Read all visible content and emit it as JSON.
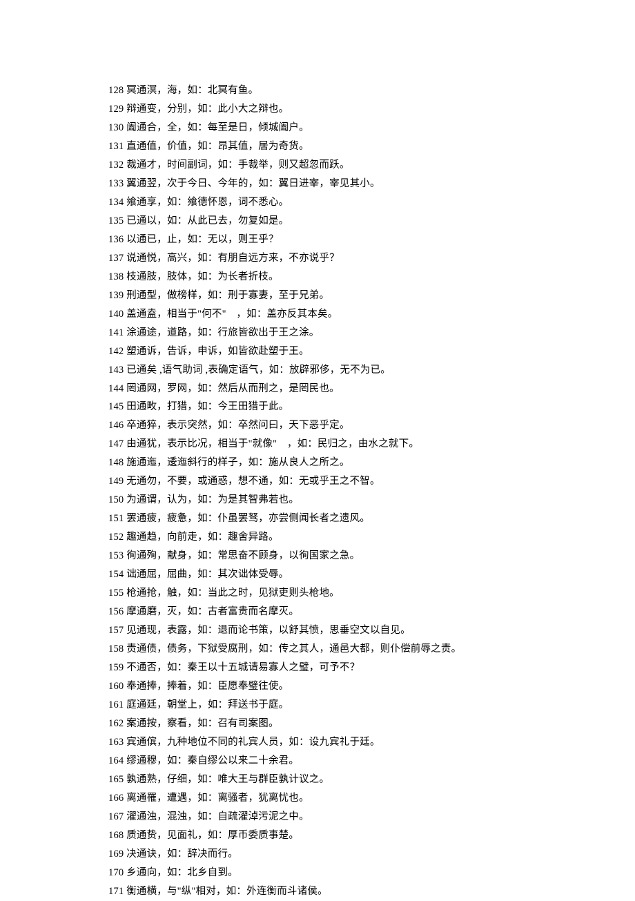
{
  "entries": [
    {
      "num": 128,
      "text": "冥通溟，海，如：北冥有鱼。"
    },
    {
      "num": 129,
      "text": "辩通变，分别，如：此小大之辩也。"
    },
    {
      "num": 130,
      "text": "阖通合，全，如：每至是日，倾城阖户。"
    },
    {
      "num": 131,
      "text": "直通值，价值，如：昂其值，居为奇货。"
    },
    {
      "num": 132,
      "text": "裁通才，时间副词，如：手裁举，则又超忽而跃。"
    },
    {
      "num": 133,
      "text": "翼通翌，次于今日、今年的，如：翼日进宰，宰见其小。"
    },
    {
      "num": 134,
      "text": "飨通享，如：飨德怀恩，词不悉心。"
    },
    {
      "num": 135,
      "text": "已通以，如：从此已去，勿复如是。"
    },
    {
      "num": 136,
      "text": "以通已，止，如：无以，则王乎？"
    },
    {
      "num": 137,
      "text": "说通悦，高兴，如：有朋自远方来，不亦说乎？"
    },
    {
      "num": 138,
      "text": "枝通肢，肢体，如：为长者折枝。"
    },
    {
      "num": 139,
      "text": "刑通型，做榜样，如：刑于寡妻，至于兄弟。"
    },
    {
      "num": 140,
      "text": "盖通盍，相当于\"何不\"　，如：盖亦反其本矣。"
    },
    {
      "num": 141,
      "text": "涂通途，道路，如：行旅皆欲出于王之涂。"
    },
    {
      "num": 142,
      "text": "塑通诉，告诉，申诉，如皆欲赴塑于王。"
    },
    {
      "num": 143,
      "text": "已通矣 ,语气助词 ,表确定语气，如：放辟邪侈，无不为已。"
    },
    {
      "num": 144,
      "text": "罔通网，罗网，如：然后从而刑之，是罔民也。"
    },
    {
      "num": 145,
      "text": "田通畋，打猎，如：今王田猎于此。"
    },
    {
      "num": 146,
      "text": "卒通猝，表示突然，如：卒然问曰，天下恶乎定。"
    },
    {
      "num": 147,
      "text": "由通犹，表示比况，相当于\"就像\"　，如：民归之，由水之就下。"
    },
    {
      "num": 148,
      "text": "施通迤，逶迤斜行的样子，如：施从良人之所之。"
    },
    {
      "num": 149,
      "text": "无通勿，不要，或通惑，想不通，如：无或乎王之不智。"
    },
    {
      "num": 150,
      "text": "为通谓，认为，如：为是其智弗若也。"
    },
    {
      "num": 151,
      "text": "罢通疲，疲惫，如：仆虽罢驽，亦尝侧闻长者之遗风。"
    },
    {
      "num": 152,
      "text": "趣通趋，向前走，如：趣舍异路。"
    },
    {
      "num": 153,
      "text": "徇通殉，献身，如：常思奋不顾身，以徇国家之急。"
    },
    {
      "num": 154,
      "text": "诎通屈，屈曲，如：其次诎体受辱。"
    },
    {
      "num": 155,
      "text": "枪通抢，触，如：当此之时，见狱吏则头枪地。"
    },
    {
      "num": 156,
      "text": "摩通磨，灭，如：古者富贵而名摩灭。"
    },
    {
      "num": 157,
      "text": "见通现，表露，如：退而论书策，以舒其愤，思垂空文以自见。"
    },
    {
      "num": 158,
      "text": "责通债，债务，下狱受腐刑，如：传之其人，通邑大都，则仆偿前辱之责。"
    },
    {
      "num": 159,
      "text": "不通否，如：秦王以十五城请易寡人之璧，可予不？"
    },
    {
      "num": 160,
      "text": "奉通捧，捧着，如：臣愿奉璧往使。"
    },
    {
      "num": 161,
      "text": "庭通廷，朝堂上，如：拜送书于庭。"
    },
    {
      "num": 162,
      "text": "案通按，察看，如：召有司案图。"
    },
    {
      "num": 163,
      "text": "宾通傧，九种地位不同的礼宾人员，如：设九宾礼于廷。"
    },
    {
      "num": 164,
      "text": "缪通穆，如：秦自缪公以来二十余君。"
    },
    {
      "num": 165,
      "text": "孰通熟，仔细，如：唯大王与群臣孰计议之。"
    },
    {
      "num": 166,
      "text": "离通罹，遭遇，如：离骚者，犹离忧也。"
    },
    {
      "num": 167,
      "text": "濯通浊，混浊，如：自疏濯淖污泥之中。"
    },
    {
      "num": 168,
      "text": "质通贽，见面礼，如：厚币委质事楚。"
    },
    {
      "num": 169,
      "text": "决通诀，如：辞决而行。"
    },
    {
      "num": 170,
      "text": "乡通向，如：北乡自到。"
    },
    {
      "num": 171,
      "text": "衡通横，与\"纵\"相对，如：外连衡而斗诸侯。"
    }
  ]
}
